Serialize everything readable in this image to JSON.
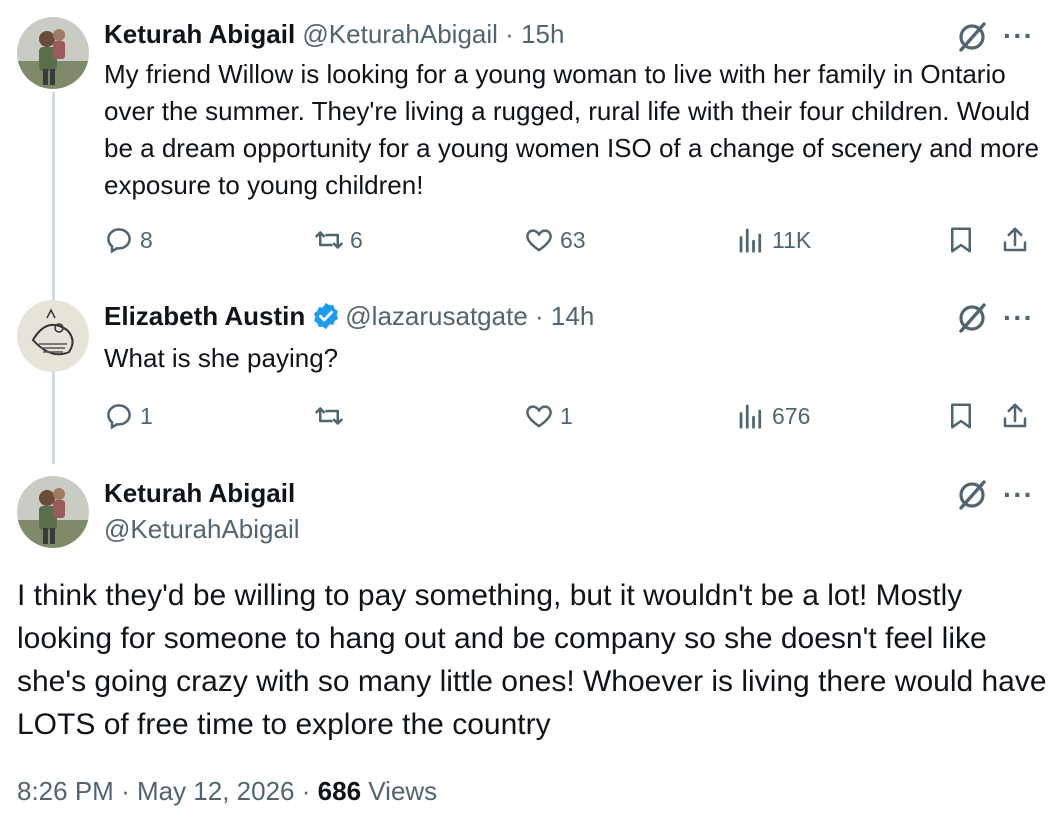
{
  "tweet1": {
    "name": "Keturah Abigail",
    "handle": "@KeturahAbigail",
    "separator": "·",
    "time": "15h",
    "text": "My friend Willow is looking for a young woman to live with her family in Ontario over the summer. They're living a rugged, rural life with their four children. Would be a dream opportunity for a young women ISO of a change of scenery and more exposure to young children!",
    "replies": "8",
    "reposts": "6",
    "likes": "63",
    "views": "11K"
  },
  "tweet2": {
    "name": "Elizabeth Austin",
    "handle": "@lazarusatgate",
    "separator": "·",
    "time": "14h",
    "text": "What is she paying?",
    "replies": "1",
    "reposts": "",
    "likes": "1",
    "views": "676"
  },
  "main": {
    "name": "Keturah Abigail",
    "handle": "@KeturahAbigail",
    "text": "I think they'd be willing to pay something, but it wouldn't be a lot! Mostly looking for someone to hang out and be company so she doesn't feel like she's going crazy with so many little ones! Whoever is living there would have LOTS of free time to explore the country",
    "time": "8:26 PM",
    "dot1": "·",
    "date": "May 12, 2026",
    "dot2": "·",
    "views_count": "686",
    "views_label": "Views"
  },
  "icons": {
    "more": "···",
    "more_icon": "more-horizontal-icon",
    "grok_icon": "grok-icon",
    "reply_icon": "reply-icon",
    "repost_icon": "repost-icon",
    "like_icon": "heart-icon",
    "views_icon": "views-icon",
    "bookmark_icon": "bookmark-icon",
    "share_icon": "share-icon",
    "verified_icon": "verified-badge-icon"
  },
  "colors": {
    "text": "#0f1419",
    "secondary": "#536471",
    "verified": "#1d9bf0",
    "thread_line": "#cfd9de"
  }
}
